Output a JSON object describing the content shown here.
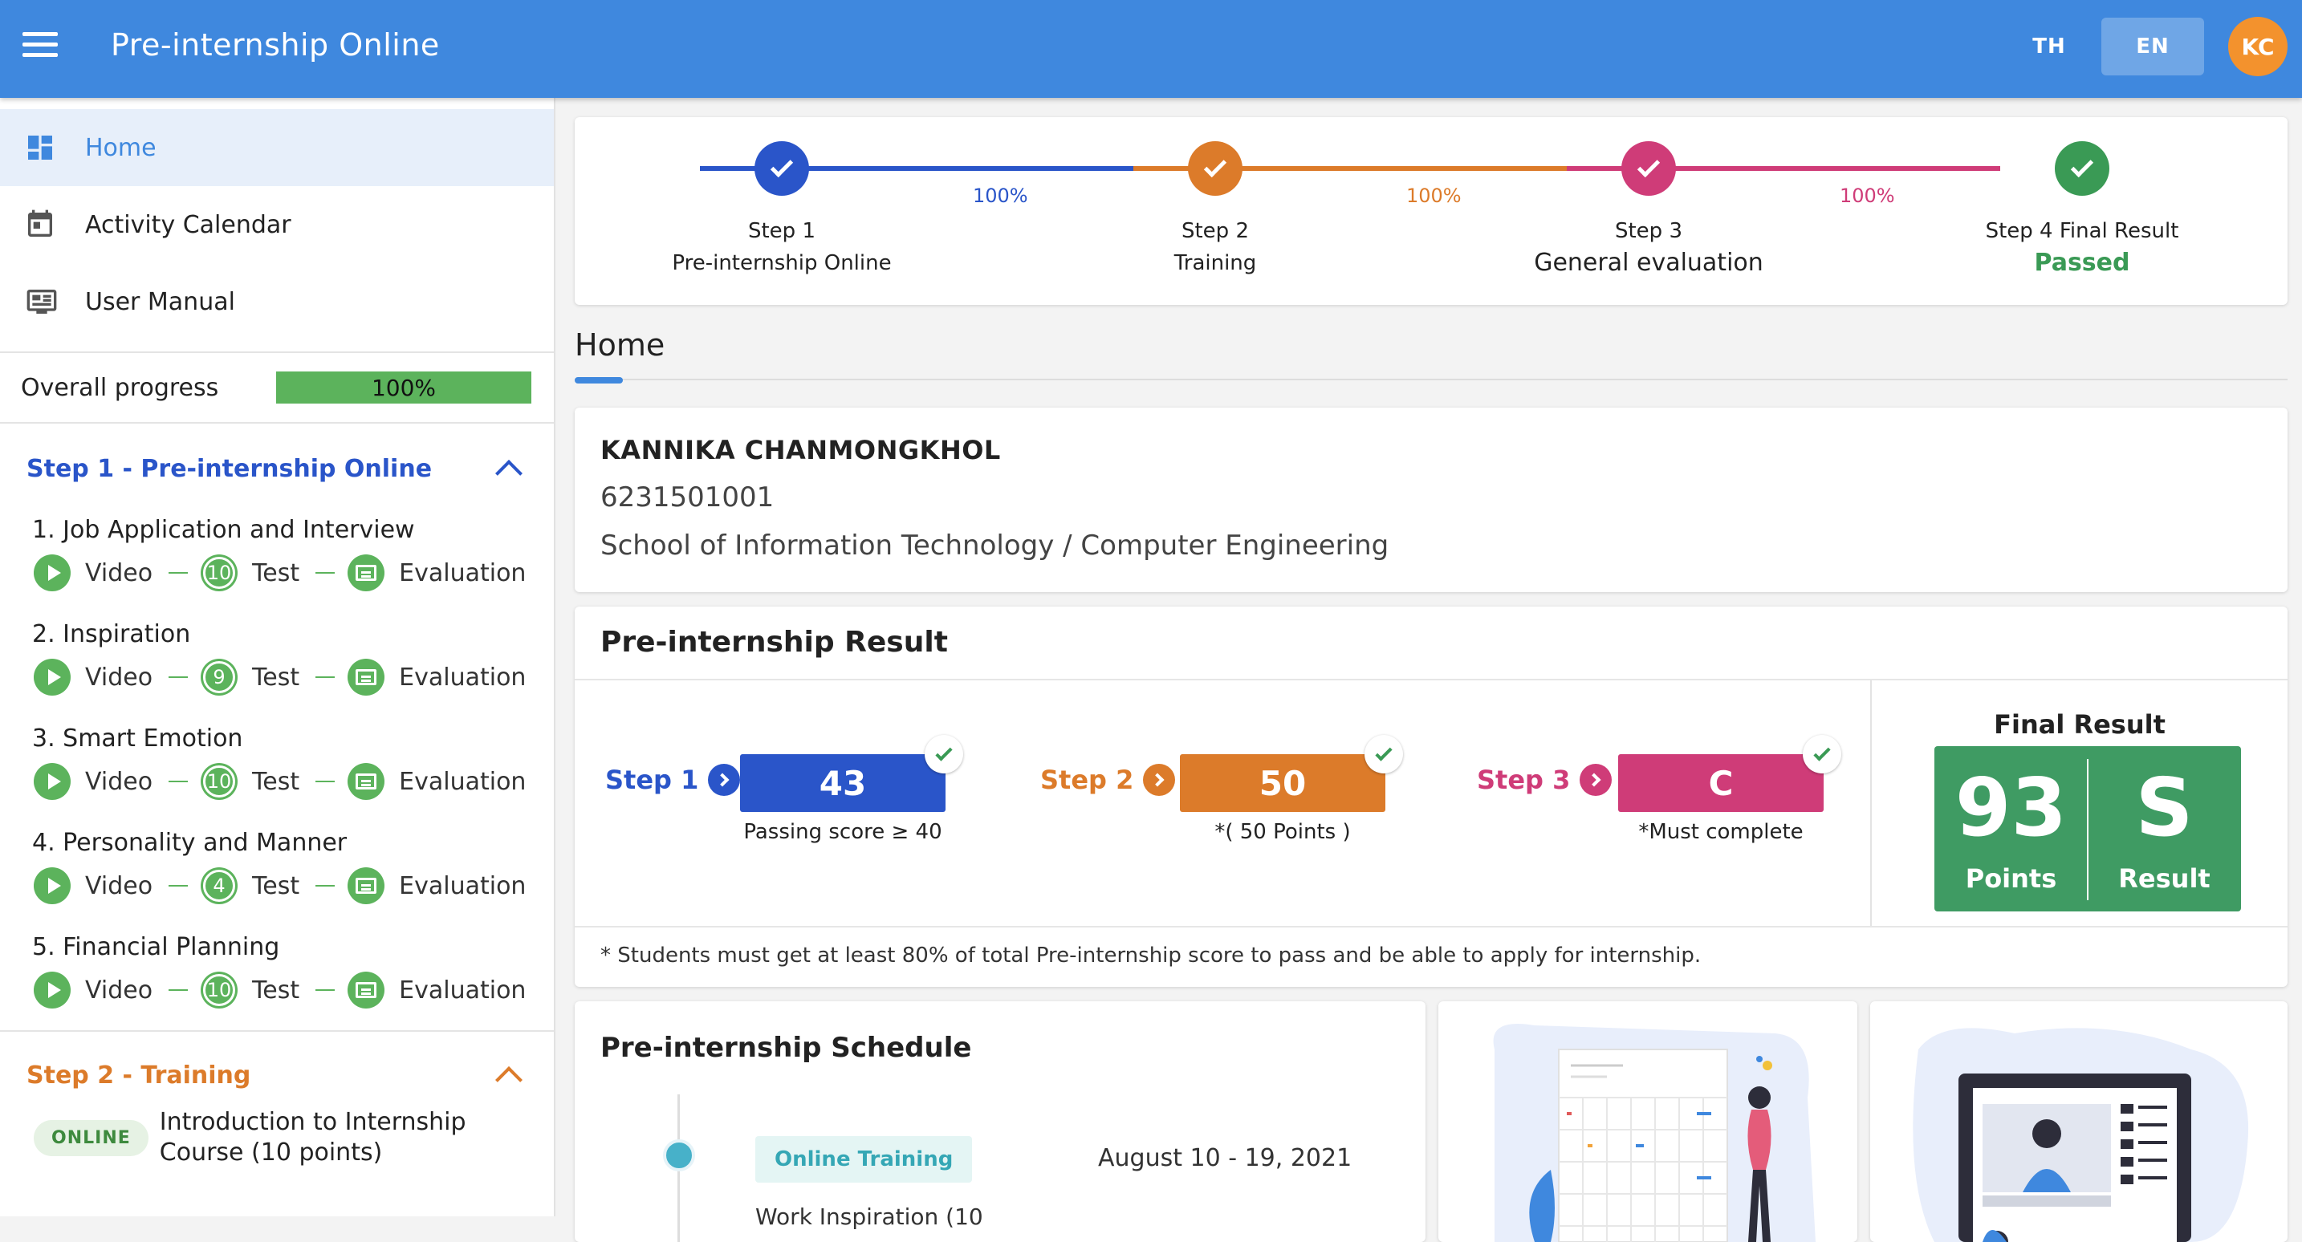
{
  "appbar": {
    "title": "Pre-internship Online",
    "lang_th": "TH",
    "lang_en": "EN",
    "avatar_initials": "KC"
  },
  "sidebar": {
    "nav": [
      {
        "label": "Home",
        "icon": "dashboard-icon"
      },
      {
        "label": "Activity Calendar",
        "icon": "calendar-icon"
      },
      {
        "label": "User Manual",
        "icon": "manual-icon"
      }
    ],
    "overall_progress_label": "Overall progress",
    "overall_progress_value": "100%",
    "step1_title": "Step 1 - Pre-internship Online",
    "lessons": [
      {
        "title": "1. Job Application and Interview",
        "test_count": "10"
      },
      {
        "title": "2. Inspiration",
        "test_count": "9"
      },
      {
        "title": "3. Smart Emotion",
        "test_count": "10"
      },
      {
        "title": "4. Personality and Manner",
        "test_count": "4"
      },
      {
        "title": "5. Financial Planning",
        "test_count": "10"
      }
    ],
    "video_label": "Video",
    "test_label": "Test",
    "evaluation_label": "Evaluation",
    "step2_title": "Step 2 - Training",
    "online_badge": "ONLINE",
    "training_course": "Introduction to Internship Course (10 points)"
  },
  "stepper": {
    "steps": [
      {
        "line1": "Step 1",
        "line2": "Pre-internship Online",
        "color": "#2a55c9"
      },
      {
        "line1": "Step 2",
        "line2": "Training",
        "color": "#dc7b2a"
      },
      {
        "line1": "Step 3",
        "line2": "General evaluation",
        "color": "#cf3c78"
      },
      {
        "line1": "Step 4 Final Result",
        "line2": "Passed",
        "color": "#3a9a55"
      }
    ],
    "percents": [
      "100%",
      "100%",
      "100%"
    ]
  },
  "home": {
    "title": "Home"
  },
  "profile": {
    "name": "KANNIKA CHANMONGKHOL",
    "student_id": "6231501001",
    "school": "School of Information Technology / Computer Engineering"
  },
  "result": {
    "title": "Pre-internship Result",
    "step1": {
      "label": "Step 1",
      "value": "43",
      "note": "Passing score ≥ 40"
    },
    "step2": {
      "label": "Step 2",
      "value": "50",
      "note": "*( 50 Points )"
    },
    "step3": {
      "label": "Step 3",
      "value": "C",
      "note": "*Must complete"
    },
    "final_title": "Final Result",
    "final_points": "93",
    "final_points_label": "Points",
    "final_grade": "S",
    "final_grade_label": "Result",
    "footnote": "* Students must get at least 80% of total Pre-internship score to pass and be able to apply for internship."
  },
  "schedule": {
    "title": "Pre-internship Schedule",
    "tag": "Online Training",
    "date": "August 10 - 19, 2021",
    "next_item": "Work Inspiration (10"
  }
}
